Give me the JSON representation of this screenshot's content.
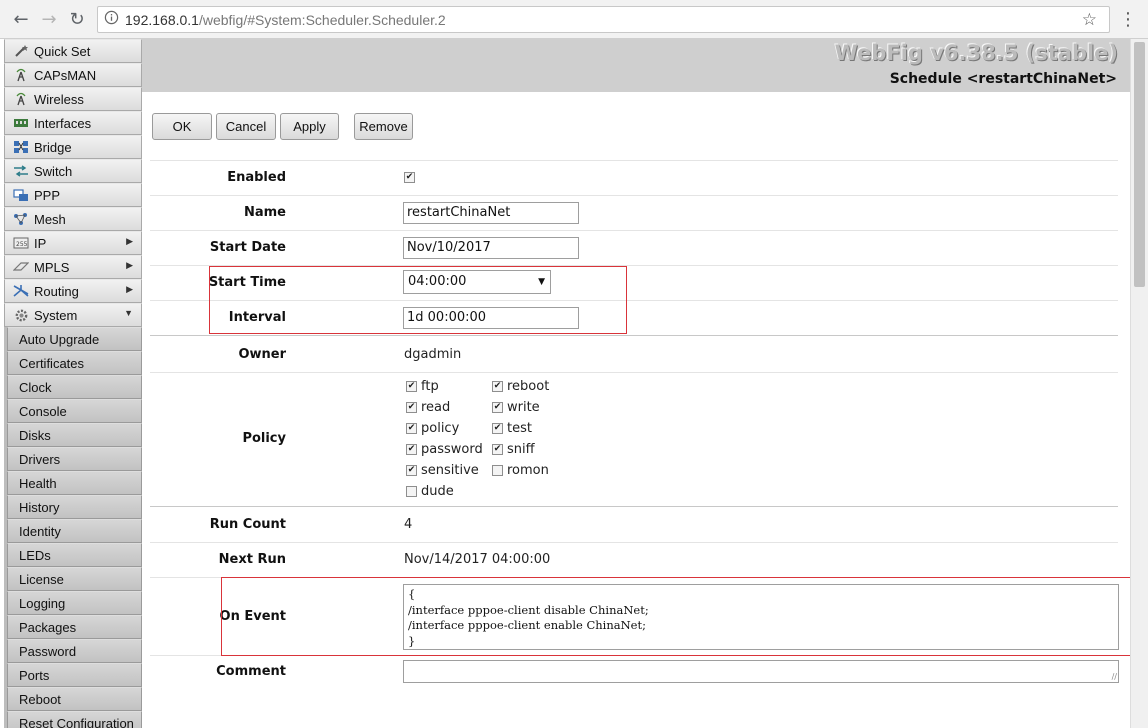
{
  "browser": {
    "url_host": "192.168.0.1",
    "url_path": "/webfig/#System:Scheduler.Scheduler.2"
  },
  "sidebar": {
    "items": [
      {
        "label": "Quick Set",
        "icon": "wand-icon"
      },
      {
        "label": "CAPsMAN",
        "icon": "antenna-icon"
      },
      {
        "label": "Wireless",
        "icon": "antenna-icon"
      },
      {
        "label": "Interfaces",
        "icon": "interfaces-icon"
      },
      {
        "label": "Bridge",
        "icon": "bridge-icon"
      },
      {
        "label": "Switch",
        "icon": "switch-icon"
      },
      {
        "label": "PPP",
        "icon": "ppp-icon"
      },
      {
        "label": "Mesh",
        "icon": "mesh-icon"
      },
      {
        "label": "IP",
        "icon": "ip-icon",
        "arrow": "right"
      },
      {
        "label": "MPLS",
        "icon": "mpls-icon",
        "arrow": "right"
      },
      {
        "label": "Routing",
        "icon": "routing-icon",
        "arrow": "right"
      },
      {
        "label": "System",
        "icon": "gear-icon",
        "arrow": "down"
      }
    ],
    "system_subitems": [
      "Auto Upgrade",
      "Certificates",
      "Clock",
      "Console",
      "Disks",
      "Drivers",
      "Health",
      "History",
      "Identity",
      "LEDs",
      "License",
      "Logging",
      "Packages",
      "Password",
      "Ports",
      "Reboot",
      "Reset Configuration"
    ]
  },
  "header": {
    "product": "WebFig v6.38.5 (stable)",
    "title": "Schedule <restartChinaNet>"
  },
  "toolbar": {
    "ok": "OK",
    "cancel": "Cancel",
    "apply": "Apply",
    "remove": "Remove"
  },
  "form": {
    "enabled_label": "Enabled",
    "enabled": true,
    "name_label": "Name",
    "name_value": "restartChinaNet",
    "start_date_label": "Start Date",
    "start_date_value": "Nov/10/2017",
    "start_time_label": "Start Time",
    "start_time_value": "04:00:00",
    "interval_label": "Interval",
    "interval_value": "1d 00:00:00",
    "owner_label": "Owner",
    "owner_value": "dgadmin",
    "policy_label": "Policy",
    "policies": {
      "ftp": {
        "label": "ftp",
        "checked": true
      },
      "reboot": {
        "label": "reboot",
        "checked": true
      },
      "read": {
        "label": "read",
        "checked": true
      },
      "write": {
        "label": "write",
        "checked": true
      },
      "policy": {
        "label": "policy",
        "checked": true
      },
      "test": {
        "label": "test",
        "checked": true
      },
      "password": {
        "label": "password",
        "checked": true
      },
      "sniff": {
        "label": "sniff",
        "checked": true
      },
      "sensitive": {
        "label": "sensitive",
        "checked": true
      },
      "romon": {
        "label": "romon",
        "checked": false
      },
      "dude": {
        "label": "dude",
        "checked": false
      }
    },
    "run_count_label": "Run Count",
    "run_count_value": "4",
    "next_run_label": "Next Run",
    "next_run_value": "Nov/14/2017 04:00:00",
    "on_event_label": "On Event",
    "on_event_value": "{\n/interface pppoe-client disable ChinaNet;\n/interface pppoe-client enable ChinaNet;\n}",
    "comment_label": "Comment",
    "comment_value": ""
  },
  "colors": {
    "highlight": "#d9343a"
  }
}
